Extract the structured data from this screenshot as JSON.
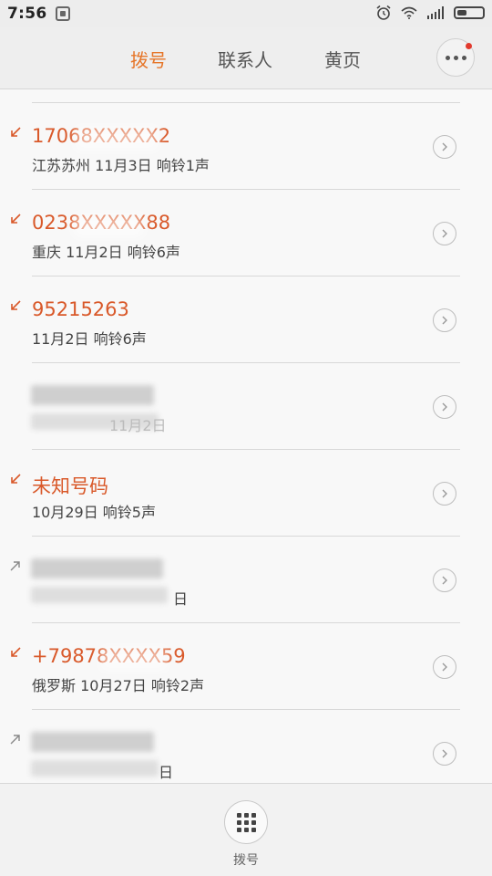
{
  "status_bar": {
    "time": "7:56",
    "icons": [
      "alarm-icon",
      "wifi-icon",
      "signal-icon",
      "battery-icon"
    ]
  },
  "tabs": [
    {
      "label": "拨号",
      "active": true
    },
    {
      "label": "联系人",
      "active": false
    },
    {
      "label": "黄页",
      "active": false
    }
  ],
  "colors": {
    "accent": "#e6762a",
    "missed": "#d9592a",
    "badge": "#e23a2e"
  },
  "calls": [
    {
      "type": "missed",
      "number": "17068XXXXX2",
      "detail": "江苏苏州 11月3日 响铃1声",
      "blurred": true
    },
    {
      "type": "missed",
      "number": "0238XXXXX88",
      "detail": "重庆 11月2日 响铃6声",
      "blurred": true
    },
    {
      "type": "missed",
      "number": "95215263",
      "detail": "11月2日 响铃6声",
      "blurred": false
    },
    {
      "type": "outgoing",
      "number": "",
      "detail": "11月2日",
      "blurred": true
    },
    {
      "type": "missed",
      "number": "未知号码",
      "detail": "10月29日 响铃5声",
      "blurred": false
    },
    {
      "type": "outgoing",
      "number": "",
      "detail": "日",
      "blurred": true
    },
    {
      "type": "missed",
      "number": "+79878XXXX59",
      "detail": "俄罗斯 10月27日 响铃2声",
      "blurred": true
    },
    {
      "type": "outgoing",
      "number": "",
      "detail": "日",
      "blurred": true
    }
  ],
  "bottom": {
    "dialpad_label": "拨号"
  }
}
